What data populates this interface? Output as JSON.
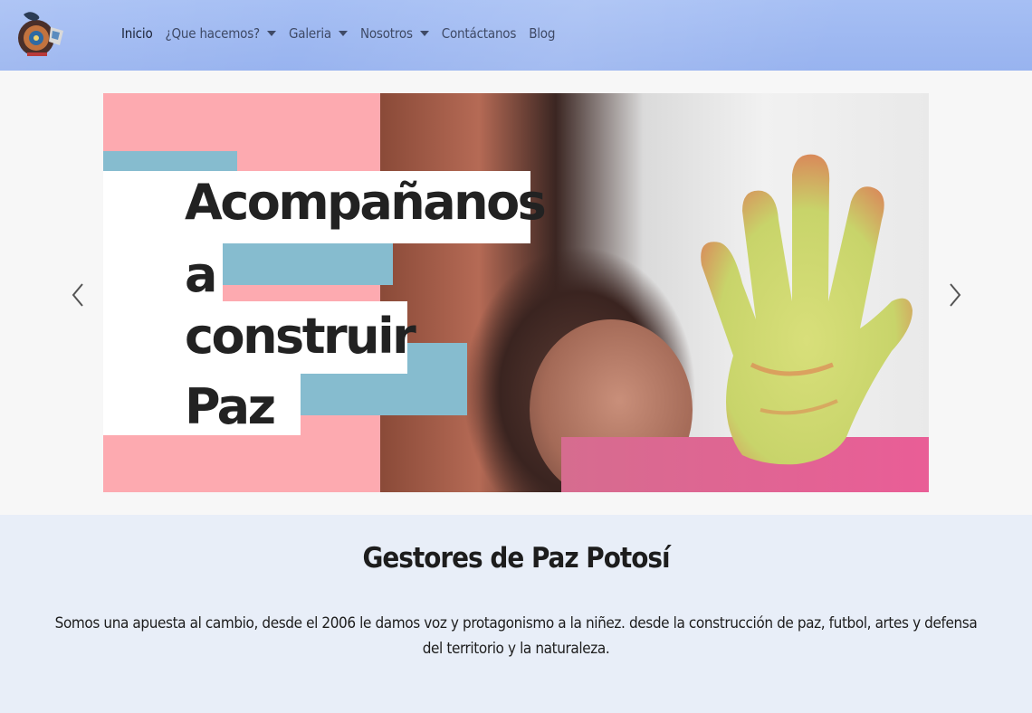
{
  "navbar": {
    "logo_icon": "organization-logo-icon",
    "items": [
      {
        "label": "Inicio",
        "dropdown": false,
        "active": true
      },
      {
        "label": "¿Que hacemos?",
        "dropdown": true,
        "active": false
      },
      {
        "label": "Galeria",
        "dropdown": true,
        "active": false
      },
      {
        "label": "Nosotros",
        "dropdown": true,
        "active": false
      },
      {
        "label": "Contáctanos",
        "dropdown": false,
        "active": false
      },
      {
        "label": "Blog",
        "dropdown": false,
        "active": false
      }
    ],
    "background_color": "#9fb9f2"
  },
  "carousel": {
    "headline_lines": [
      "Acompañanos",
      "a",
      "construir",
      "Paz"
    ],
    "prev_icon": "chevron-left-icon",
    "next_icon": "chevron-right-icon",
    "accent_pink": "#fdaab0",
    "accent_blue": "#86bccf"
  },
  "intro": {
    "title": "Gestores de Paz Potosí",
    "text": "Somos una apuesta al cambio, desde el 2006 le damos voz y protagonismo a la niñez. desde la construcción de paz, futbol, artes y defensa del territorio y la naturaleza.",
    "background_color": "#e8eef8"
  }
}
